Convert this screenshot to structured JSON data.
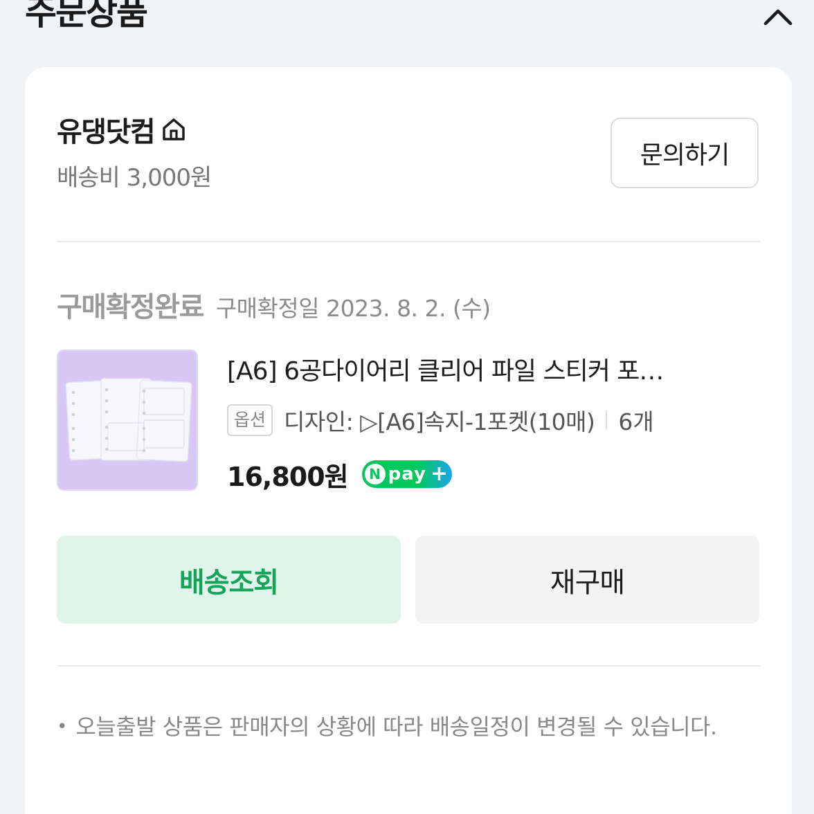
{
  "section": {
    "title": "주문상품"
  },
  "store": {
    "name": "유댕닷컴",
    "shipping_fee": "배송비 3,000원",
    "inquiry_label": "문의하기"
  },
  "order": {
    "status": "구매확정완료",
    "confirm_date": "구매확정일 2023. 8. 2. (수)"
  },
  "product": {
    "title": "[A6] 6공다이어리 클리어 파일 스티커 포…",
    "option_badge": "옵션",
    "option_text": "디자인: ▷[A6]속지-1포켓(10매)",
    "quantity": "6개",
    "price": "16,800원",
    "npay_text": "pay"
  },
  "actions": {
    "delivery_label": "배송조회",
    "rebuy_label": "재구매"
  },
  "notice": {
    "text": "오늘출발 상품은 판매자의 상황에 따라 배송일정이 변경될 수 있습니다."
  },
  "colors": {
    "accent_green": "#16a35a",
    "delivery_btn_bg": "#dff5ea",
    "npay_green": "#03c75a"
  }
}
